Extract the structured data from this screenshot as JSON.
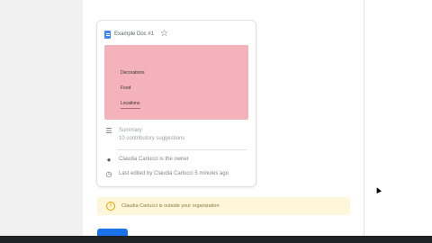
{
  "doc": {
    "title": "Example Doc #1",
    "thumbnail_items": [
      "Decorations",
      "Food",
      "Locations"
    ]
  },
  "summary": {
    "label": "Summary",
    "text": "10 contributory suggestions"
  },
  "owner": {
    "text": "Claudia Carlucci is the owner"
  },
  "last_edit": {
    "text": "Last edited by Claudia Carlucci 5 minutes ago"
  },
  "banner": {
    "text": "Claudia Carlucci is outside your organization"
  },
  "icons": {
    "doc": "docs-icon",
    "star": "star-icon",
    "summary": "summary-icon",
    "owner": "person-icon",
    "history": "clock-icon",
    "warning": "warning-icon"
  },
  "colors": {
    "thumbnail_bg": "#f4b3bb",
    "banner_bg": "#fdf6d8",
    "accent_blue": "#1a73e8"
  }
}
